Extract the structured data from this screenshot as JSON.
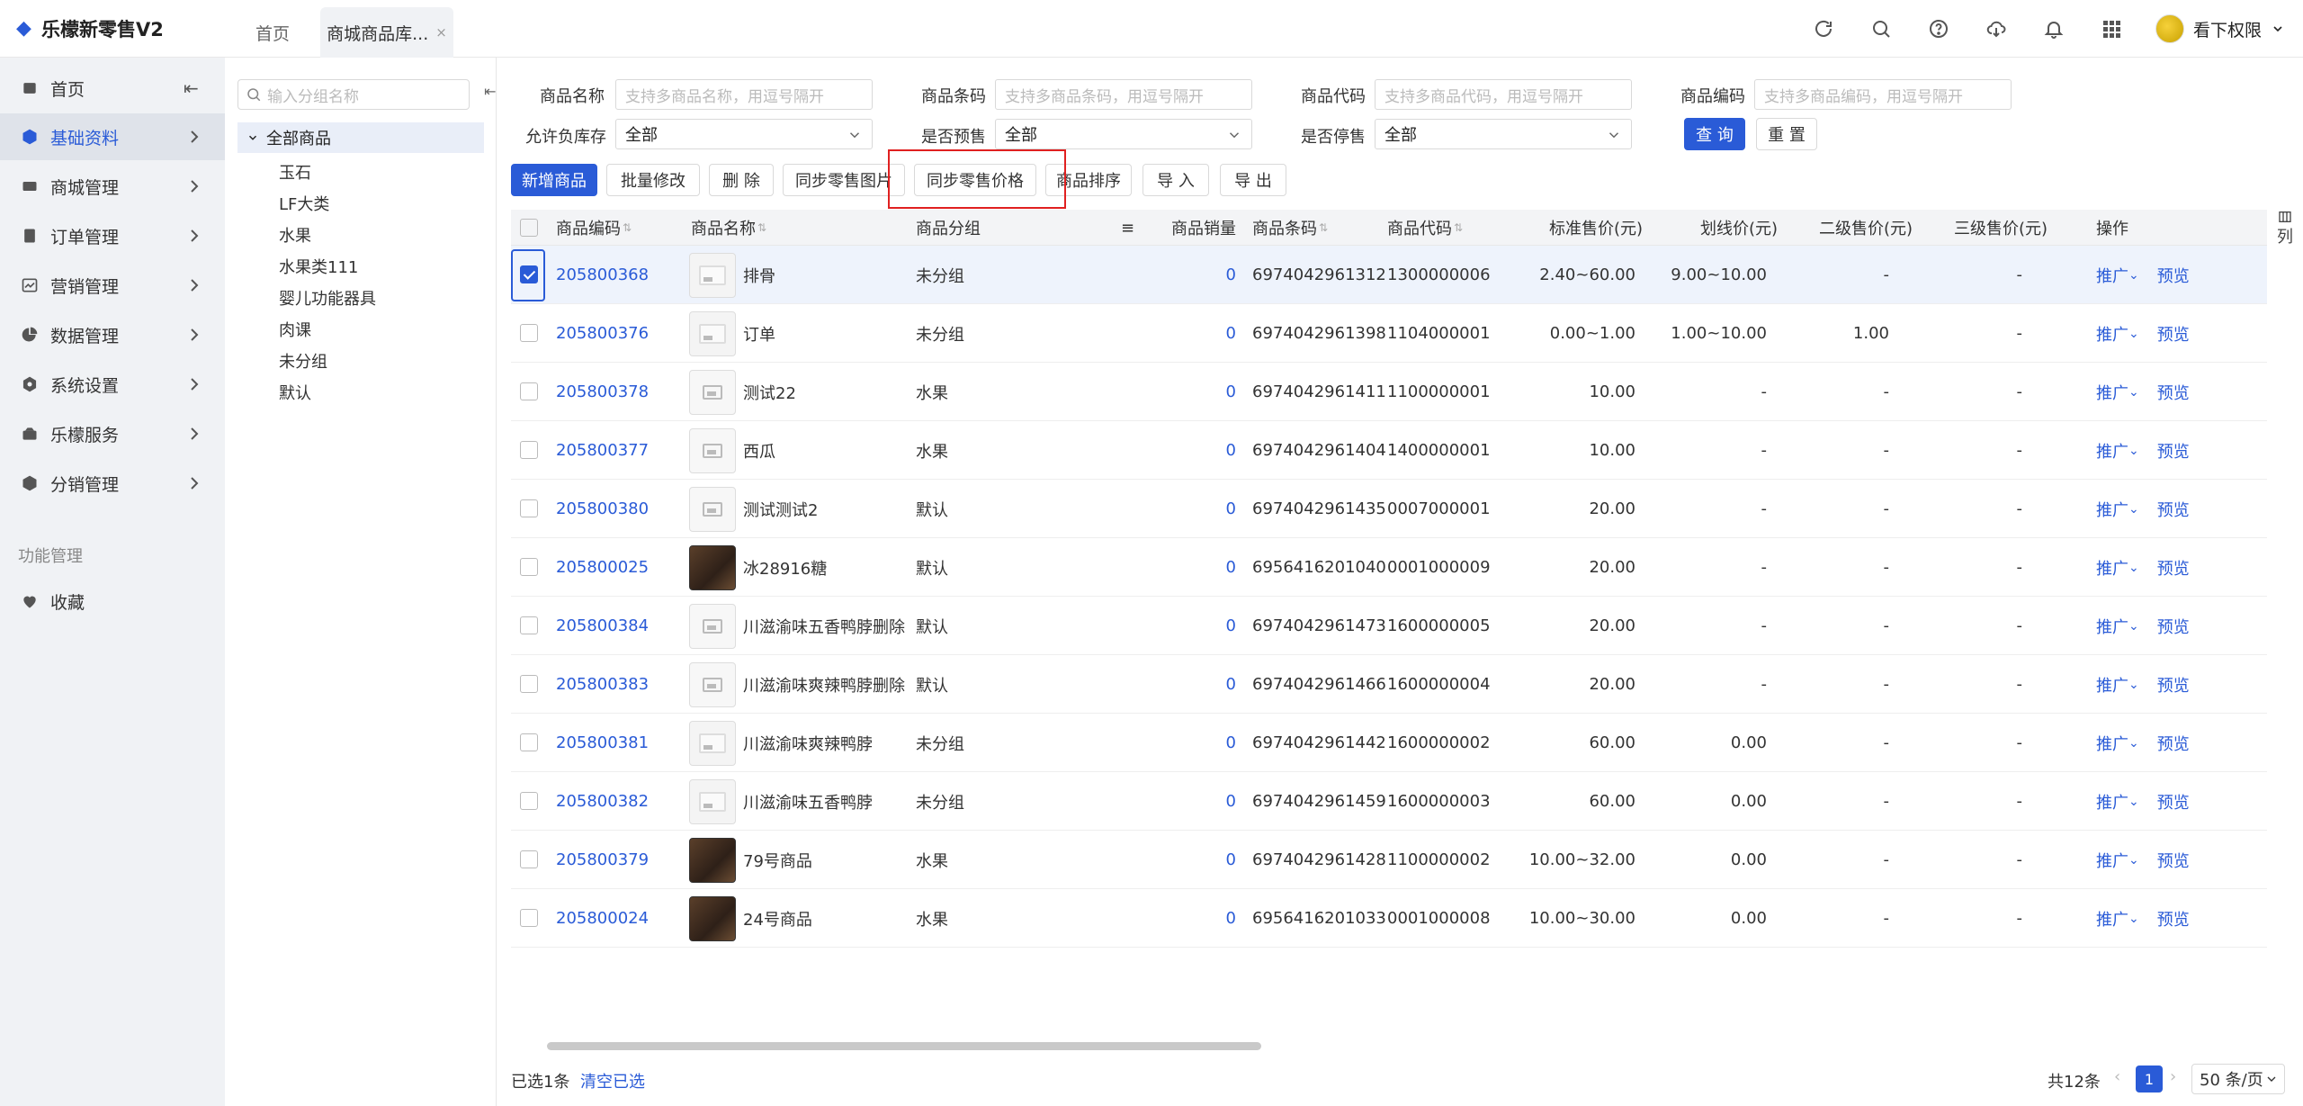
{
  "app": {
    "title": "乐檬新零售V2"
  },
  "tabs": [
    {
      "label": "首页"
    },
    {
      "label": "商城商品库...",
      "close": "×"
    }
  ],
  "user": {
    "name": "看下权限"
  },
  "sidebar": {
    "items": [
      {
        "label": "首页",
        "icon": "home-icon"
      },
      {
        "label": "基础资料",
        "icon": "cube-icon"
      },
      {
        "label": "商城管理",
        "icon": "store-icon"
      },
      {
        "label": "订单管理",
        "icon": "order-icon"
      },
      {
        "label": "营销管理",
        "icon": "chart-icon"
      },
      {
        "label": "数据管理",
        "icon": "pie-icon"
      },
      {
        "label": "系统设置",
        "icon": "settings-icon"
      },
      {
        "label": "乐檬服务",
        "icon": "service-icon"
      },
      {
        "label": "分销管理",
        "icon": "box-icon"
      }
    ],
    "section_label": "功能管理",
    "favorites": "收藏",
    "collapse_glyph": "⇤"
  },
  "tree": {
    "search_placeholder": "输入分组名称",
    "root": "全部商品",
    "nodes": [
      "玉石",
      "LF大类",
      "水果",
      "水果类111",
      "婴儿功能器具",
      "肉课",
      "未分组",
      "默认"
    ]
  },
  "filters": {
    "name_label": "商品名称",
    "name_placeholder": "支持多商品名称，用逗号隔开",
    "barcode_label": "商品条码",
    "barcode_placeholder": "支持多商品条码，用逗号隔开",
    "code_label": "商品代码",
    "code_placeholder": "支持多商品代码，用逗号隔开",
    "number_label": "商品编码",
    "number_placeholder": "支持多商品编码，用逗号隔开",
    "neg_stock_label": "允许负库存",
    "neg_stock_value": "全部",
    "presale_label": "是否预售",
    "presale_value": "全部",
    "stopped_label": "是否停售",
    "stopped_value": "全部",
    "query": "查 询",
    "reset": "重 置"
  },
  "toolbar": {
    "add": "新增商品",
    "batch_edit": "批量修改",
    "delete": "删 除",
    "sync_images": "同步零售图片",
    "sync_prices": "同步零售价格",
    "sort": "商品排序",
    "import": "导 入",
    "export": "导 出"
  },
  "table": {
    "columns": {
      "number": "商品编码",
      "name": "商品名称",
      "group": "商品分组",
      "sales": "商品销量",
      "barcode": "商品条码",
      "code": "商品代码",
      "std_price": "标准售价(元)",
      "list_price": "划线价(元)",
      "price2": "二级售价(元)",
      "price3": "三级售价(元)",
      "ops": "操作"
    },
    "op_promote": "推广",
    "op_preview": "预览",
    "rows": [
      {
        "number": "205800368",
        "name": "排骨",
        "group": "未分组",
        "sales": "0",
        "barcode": "6974042961312",
        "code": "1300000006",
        "std": "2.40~60.00",
        "list": "9.00~10.00",
        "p2": "-",
        "p3": "-",
        "thumb": "blank",
        "checked": true
      },
      {
        "number": "205800376",
        "name": "订单",
        "group": "未分组",
        "sales": "0",
        "barcode": "6974042961398",
        "code": "1104000001",
        "std": "0.00~1.00",
        "list": "1.00~10.00",
        "p2": "1.00",
        "p3": "-",
        "thumb": "blank",
        "checked": false
      },
      {
        "number": "205800378",
        "name": "测试22",
        "group": "水果",
        "sales": "0",
        "barcode": "6974042961411",
        "code": "1100000001",
        "std": "10.00",
        "list": "-",
        "p2": "-",
        "p3": "-",
        "thumb": "placeholder",
        "checked": false
      },
      {
        "number": "205800377",
        "name": "西瓜",
        "group": "水果",
        "sales": "0",
        "barcode": "6974042961404",
        "code": "1400000001",
        "std": "10.00",
        "list": "-",
        "p2": "-",
        "p3": "-",
        "thumb": "placeholder",
        "checked": false
      },
      {
        "number": "205800380",
        "name": "测试测试2",
        "group": "默认",
        "sales": "0",
        "barcode": "6974042961435",
        "code": "0007000001",
        "std": "20.00",
        "list": "-",
        "p2": "-",
        "p3": "-",
        "thumb": "placeholder",
        "checked": false
      },
      {
        "number": "205800025",
        "name": "冰28916糖",
        "group": "默认",
        "sales": "0",
        "barcode": "6956416201040",
        "code": "0001000009",
        "std": "20.00",
        "list": "-",
        "p2": "-",
        "p3": "-",
        "thumb": "photo",
        "checked": false
      },
      {
        "number": "205800384",
        "name": "川滋渝味五香鸭脖删除",
        "group": "默认",
        "sales": "0",
        "barcode": "6974042961473",
        "code": "1600000005",
        "std": "20.00",
        "list": "-",
        "p2": "-",
        "p3": "-",
        "thumb": "placeholder",
        "checked": false
      },
      {
        "number": "205800383",
        "name": "川滋渝味爽辣鸭脖删除",
        "group": "默认",
        "sales": "0",
        "barcode": "6974042961466",
        "code": "1600000004",
        "std": "20.00",
        "list": "-",
        "p2": "-",
        "p3": "-",
        "thumb": "placeholder",
        "checked": false
      },
      {
        "number": "205800381",
        "name": "川滋渝味爽辣鸭脖",
        "group": "未分组",
        "sales": "0",
        "barcode": "6974042961442",
        "code": "1600000002",
        "std": "60.00",
        "list": "0.00",
        "p2": "-",
        "p3": "-",
        "thumb": "blank",
        "checked": false
      },
      {
        "number": "205800382",
        "name": "川滋渝味五香鸭脖",
        "group": "未分组",
        "sales": "0",
        "barcode": "6974042961459",
        "code": "1600000003",
        "std": "60.00",
        "list": "0.00",
        "p2": "-",
        "p3": "-",
        "thumb": "blank",
        "checked": false
      },
      {
        "number": "205800379",
        "name": "79号商品",
        "group": "水果",
        "sales": "0",
        "barcode": "6974042961428",
        "code": "1100000002",
        "std": "10.00~32.00",
        "list": "0.00",
        "p2": "-",
        "p3": "-",
        "thumb": "photo",
        "checked": false
      },
      {
        "number": "205800024",
        "name": "24号商品",
        "group": "水果",
        "sales": "0",
        "barcode": "6956416201033",
        "code": "0001000008",
        "std": "10.00~30.00",
        "list": "0.00",
        "p2": "-",
        "p3": "-",
        "thumb": "photo",
        "checked": false
      }
    ]
  },
  "column_setting": {
    "icon": "columns-icon",
    "label": "列"
  },
  "footer": {
    "selected": "已选1条",
    "clear": "清空已选",
    "total": "共12条",
    "page": "1",
    "page_size": "50 条/页"
  },
  "colors": {
    "primary": "#2a5bd7",
    "highlight": "#e02020"
  }
}
